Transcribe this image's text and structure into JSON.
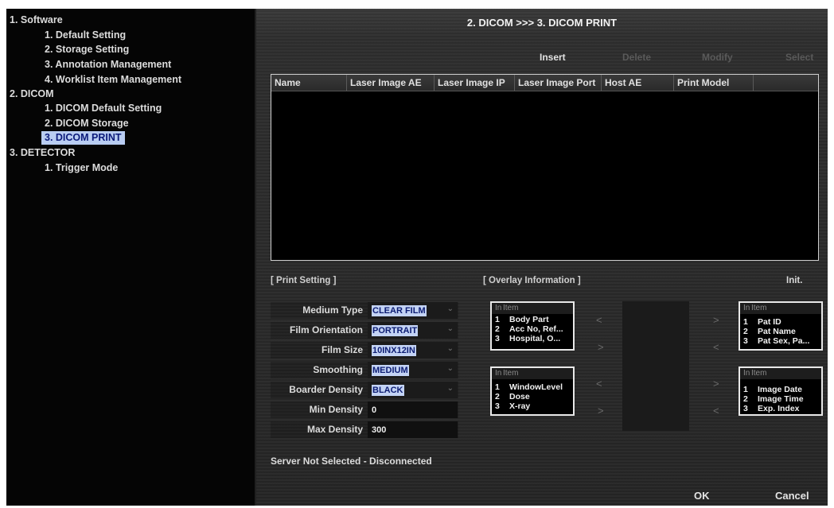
{
  "sidebar": {
    "items": [
      {
        "label": "1. Software"
      },
      {
        "label": "1. Default Setting"
      },
      {
        "label": "2. Storage Setting"
      },
      {
        "label": "3. Annotation Management"
      },
      {
        "label": "4. Worklist Item Management"
      },
      {
        "label": "2. DICOM"
      },
      {
        "label": "1. DICOM Default Setting"
      },
      {
        "label": "2. DICOM Storage"
      },
      {
        "label": "3. DICOM PRINT"
      },
      {
        "label": "3. DETECTOR"
      },
      {
        "label": "1. Trigger Mode"
      }
    ]
  },
  "header": {
    "title": "2. DICOM >>> 3. DICOM PRINT"
  },
  "toolbar": {
    "insert": "Insert",
    "delete": "Delete",
    "modify": "Modify",
    "select": "Select"
  },
  "server_table": {
    "columns": [
      "Name",
      "Laser Image AE",
      "Laser Image IP",
      "Laser Image Port",
      "Host AE",
      "Print Model"
    ]
  },
  "print_setting": {
    "title": "[ Print Setting ]",
    "medium_type": {
      "label": "Medium Type",
      "value": "CLEAR FILM"
    },
    "film_orientation": {
      "label": "Film Orientation",
      "value": "PORTRAIT"
    },
    "film_size": {
      "label": "Film Size",
      "value": "10INX12IN"
    },
    "smoothing": {
      "label": "Smoothing",
      "value": "MEDIUM"
    },
    "border_density": {
      "label": "Boarder Density",
      "value": "BLACK"
    },
    "min_density": {
      "label": "Min Density",
      "value": "0"
    },
    "max_density": {
      "label": "Max Density",
      "value": "300"
    }
  },
  "overlay": {
    "title": "[ Overlay Information ]",
    "init": "Init.",
    "header_index": "In",
    "header_item": "Item",
    "top_left": [
      {
        "n": "1",
        "t": "Body Part"
      },
      {
        "n": "2",
        "t": "Acc No, Ref..."
      },
      {
        "n": "3",
        "t": "Hospital, O..."
      }
    ],
    "bottom_left": [
      {
        "n": "1",
        "t": "WindowLevel"
      },
      {
        "n": "2",
        "t": "Dose"
      },
      {
        "n": "3",
        "t": "X-ray"
      }
    ],
    "top_right": [
      {
        "n": "1",
        "t": "Pat ID"
      },
      {
        "n": "2",
        "t": "Pat Name"
      },
      {
        "n": "3",
        "t": "Pat Sex, Pa..."
      }
    ],
    "bottom_right": [
      {
        "n": "1",
        "t": "Image Date"
      },
      {
        "n": "2",
        "t": "Image Time"
      },
      {
        "n": "3",
        "t": "Exp. Index"
      }
    ],
    "arrows": {
      "left": "<",
      "right": ">"
    }
  },
  "status": {
    "text": "Server Not Selected - Disconnected"
  },
  "footer": {
    "ok": "OK",
    "cancel": "Cancel"
  },
  "icons": {
    "dropdown": "chevron-down-icon",
    "arrow_left": "arrow-left-icon",
    "arrow_right": "arrow-right-icon"
  },
  "colors": {
    "selection": "#b9cdf2",
    "selection_text": "#0b1a7a",
    "panel": "#2a2a2a",
    "sidebar": "#050505"
  }
}
